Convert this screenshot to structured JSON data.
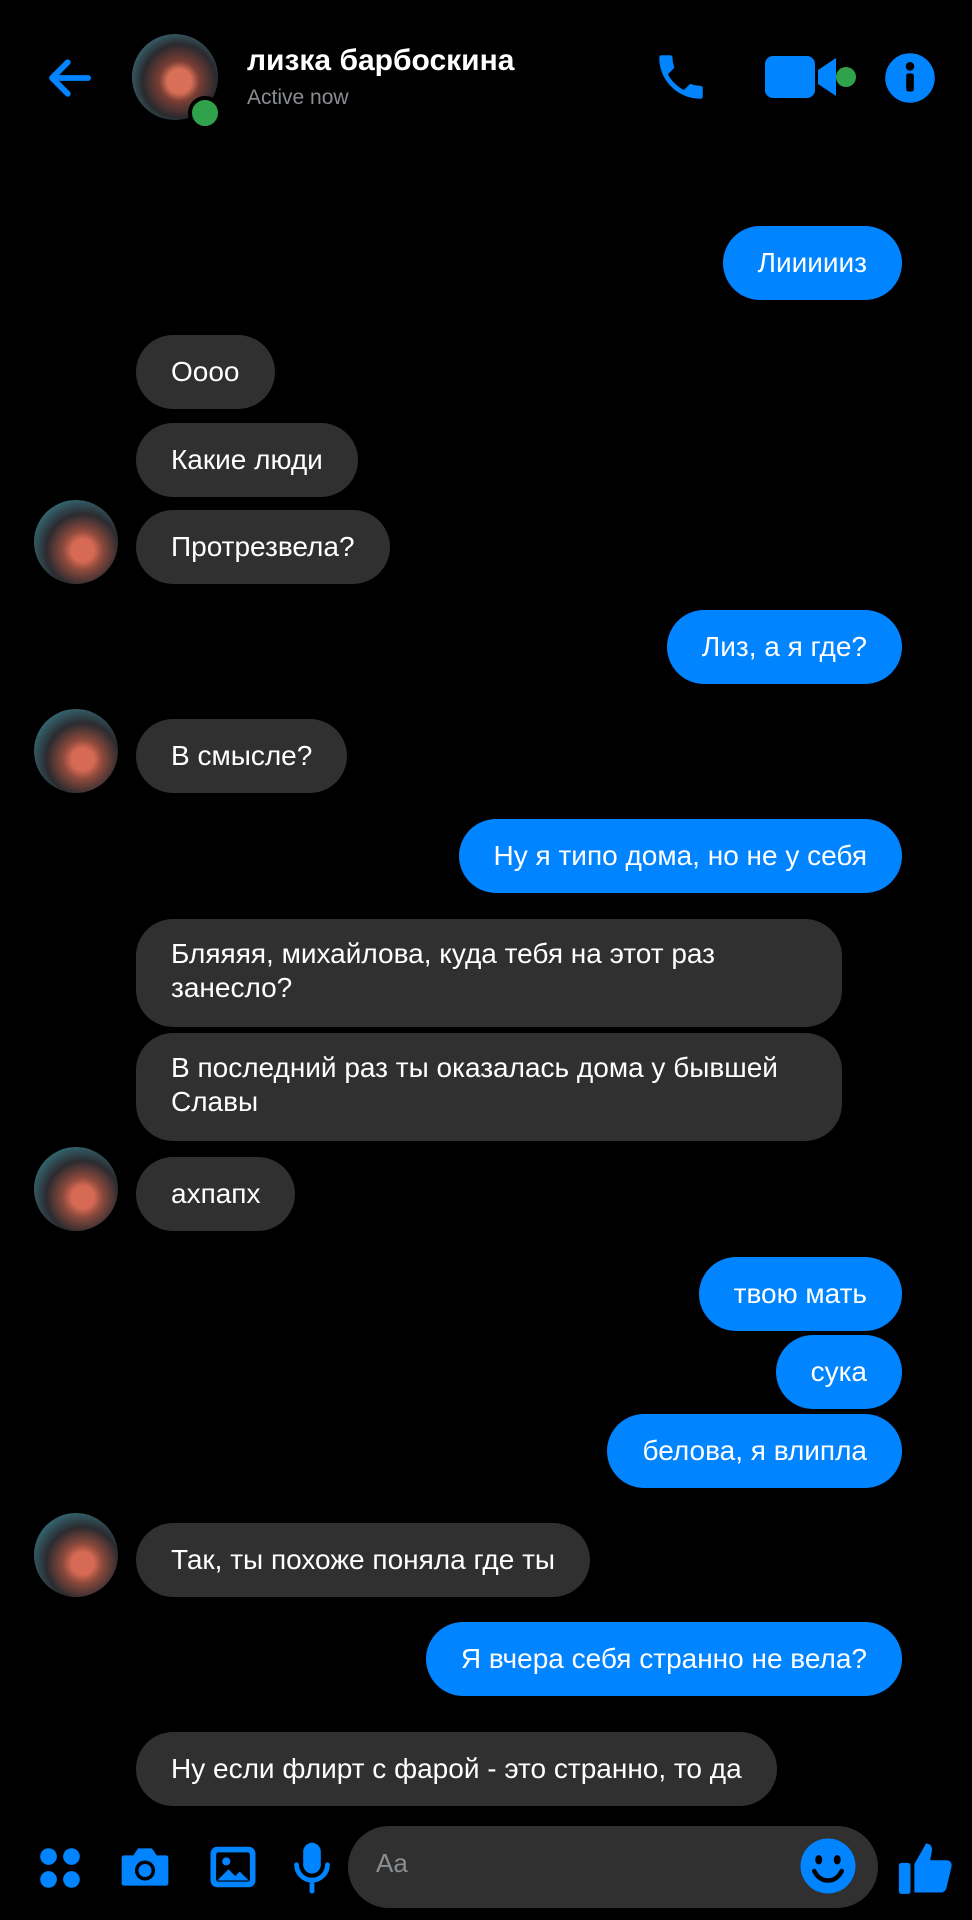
{
  "header": {
    "contact_name": "лизка барбоскина",
    "status": "Active now",
    "icons": {
      "back": "back-arrow-icon",
      "call": "phone-icon",
      "video": "video-camera-icon",
      "info": "info-icon"
    }
  },
  "colors": {
    "accent": "#0084ff",
    "incoming_bubble": "#303030",
    "online": "#31a24c",
    "background": "#000000"
  },
  "messages": [
    {
      "from": "me",
      "text": "Лиииииз"
    },
    {
      "from": "contact",
      "text": "Оооо"
    },
    {
      "from": "contact",
      "text": "Какие люди"
    },
    {
      "from": "contact",
      "text": "Протрезвела?"
    },
    {
      "from": "me",
      "text": "Лиз, а я где?"
    },
    {
      "from": "contact",
      "text": "В смысле?"
    },
    {
      "from": "me",
      "text": "Ну я типо дома, но не у себя"
    },
    {
      "from": "contact",
      "text": "Бляяяя, михайлова, куда тебя на этот раз занесло?"
    },
    {
      "from": "contact",
      "text": "В последний раз ты оказалась дома у бывшей Славы"
    },
    {
      "from": "contact",
      "text": "ахпапх"
    },
    {
      "from": "me",
      "text": "твою мать"
    },
    {
      "from": "me",
      "text": "сука"
    },
    {
      "from": "me",
      "text": "белова, я влипла"
    },
    {
      "from": "contact",
      "text": "Так, ты похоже поняла где ты"
    },
    {
      "from": "me",
      "text": "Я вчера себя странно не вела?"
    },
    {
      "from": "contact",
      "text": "Ну если флирт с фарой - это странно, то да"
    }
  ],
  "composer": {
    "placeholder": "Aa",
    "icons": [
      "apps-icon",
      "camera-icon",
      "gallery-icon",
      "microphone-icon",
      "emoji-icon",
      "thumbs-up-icon"
    ]
  }
}
